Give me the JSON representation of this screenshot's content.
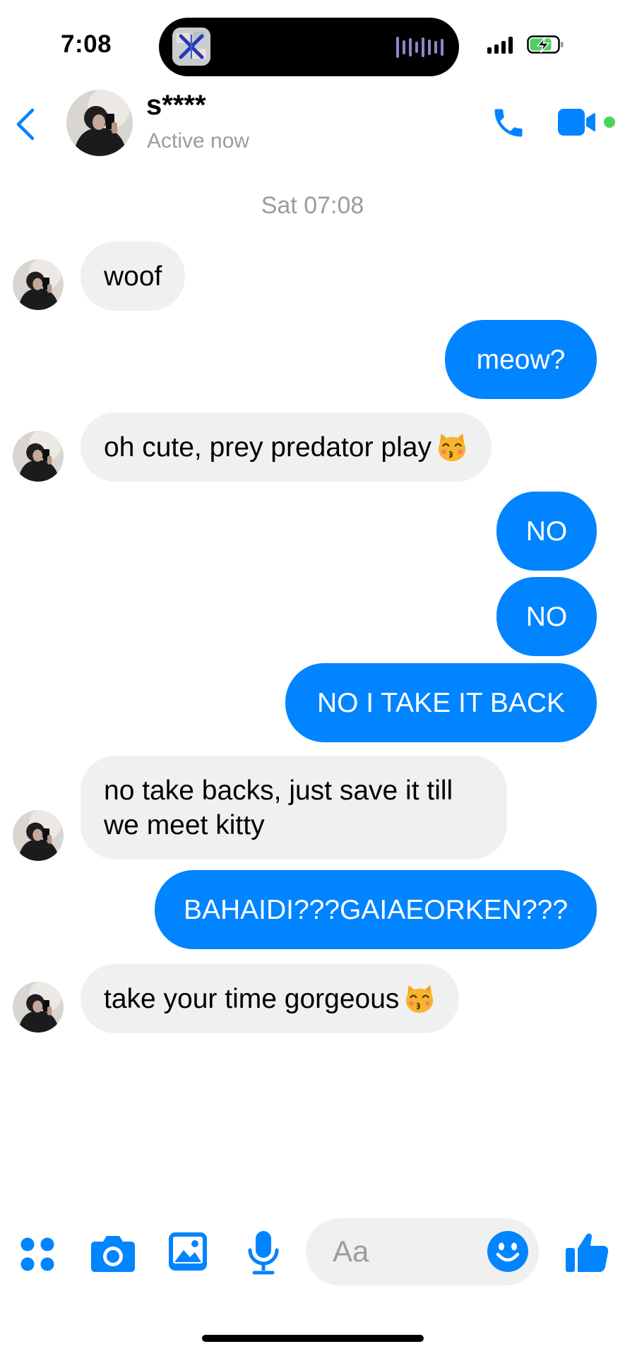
{
  "status_bar": {
    "time": "7:08",
    "island_app_icon": "app-thumbnail-icon",
    "activity_icon": "audio-waveform-icon",
    "signal_icon": "cellular-signal-icon",
    "battery_icon": "battery-charging-icon",
    "battery_color": "#4cd15e"
  },
  "header": {
    "back_icon": "chevron-left-icon",
    "contact_name": "s****",
    "contact_status": "Active now",
    "call_icon": "phone-icon",
    "video_icon": "video-camera-icon",
    "online_color": "#4cd15e",
    "accent_color": "#0084ff"
  },
  "conversation": {
    "timestamp": "Sat 07:08",
    "messages": [
      {
        "direction": "in",
        "text": "woof"
      },
      {
        "direction": "out",
        "text": "meow?"
      },
      {
        "direction": "in",
        "text": "oh cute, prey predator play",
        "emoji": "kissing-cat-emoji"
      },
      {
        "direction": "out",
        "text": "NO"
      },
      {
        "direction": "out",
        "text": "NO"
      },
      {
        "direction": "out",
        "text": "NO I TAKE IT BACK"
      },
      {
        "direction": "in",
        "text": "no take backs, just save it till we meet kitty"
      },
      {
        "direction": "out",
        "text": "BAHAIDI???GAIAEORKEN???"
      },
      {
        "direction": "in",
        "text": "take your time gorgeous ",
        "emoji": "kissing-cat-emoji"
      }
    ],
    "incoming_bubble_color": "#f0f0f0",
    "outgoing_bubble_color": "#0084ff"
  },
  "composer": {
    "menu_icon": "four-dots-menu-icon",
    "camera_icon": "camera-icon",
    "gallery_icon": "image-gallery-icon",
    "mic_icon": "microphone-icon",
    "placeholder": "Aa",
    "emoji_icon": "smiley-icon",
    "like_icon": "thumbs-up-icon"
  }
}
